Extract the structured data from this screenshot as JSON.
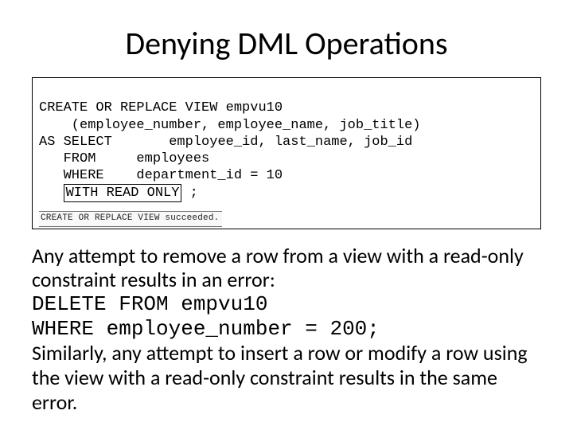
{
  "title": "Denying DML Operations",
  "code": {
    "l1": "CREATE OR REPLACE VIEW empvu10",
    "l2": "    (employee_number, employee_name, job_title)",
    "l3": "AS SELECT\temployee_id, last_name, job_id",
    "l4": "   FROM     employees",
    "l5": "   WHERE    department_id = 10",
    "l6pre": "   ",
    "l6box": "WITH READ ONLY",
    "l6post": " ;"
  },
  "result": "CREATE OR REPLACE VIEW succeeded.",
  "body": {
    "p1": "Any attempt to remove a row from a view with a read-only constraint results in an error:",
    "c1": "DELETE FROM empvu10",
    "c2": "WHERE  employee_number = 200;",
    "p2": "Similarly, any attempt to insert a row or modify a row using the view with a read-only constraint results in the same error."
  }
}
